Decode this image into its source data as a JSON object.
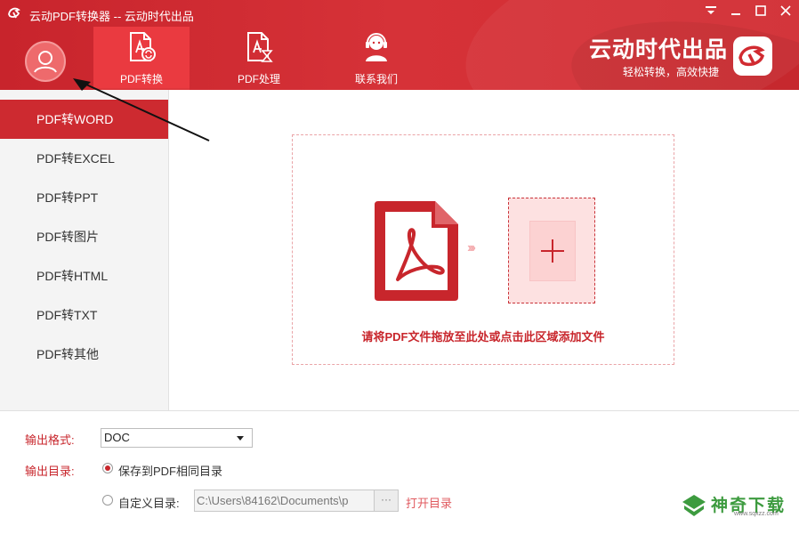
{
  "window": {
    "title": "云动PDF转换器 -- 云动时代出品",
    "buttons": [
      "minimize-dropdown",
      "minimize",
      "maximize",
      "close"
    ]
  },
  "header": {
    "tabs": [
      {
        "label": "PDF转换",
        "icon": "pdf-convert-icon",
        "active": true
      },
      {
        "label": "PDF处理",
        "icon": "pdf-process-icon",
        "active": false
      },
      {
        "label": "联系我们",
        "icon": "contact-support-icon",
        "active": false
      }
    ],
    "brand_name": "云动时代出品",
    "brand_slogan": "轻松转换，高效快捷"
  },
  "sidebar": {
    "items": [
      {
        "label": "PDF转WORD",
        "active": true
      },
      {
        "label": "PDF转EXCEL",
        "active": false
      },
      {
        "label": "PDF转PPT",
        "active": false
      },
      {
        "label": "PDF转图片",
        "active": false
      },
      {
        "label": "PDF转HTML",
        "active": false
      },
      {
        "label": "PDF转TXT",
        "active": false
      },
      {
        "label": "PDF转其他",
        "active": false
      }
    ]
  },
  "dropzone": {
    "hint": "请将PDF文件拖放至此处或点击此区域添加文件",
    "arrows": "›››"
  },
  "options": {
    "format_label": "输出格式:",
    "format_value": "DOC",
    "dir_label": "输出目录:",
    "same_dir_label": "保存到PDF相同目录",
    "same_dir_checked": true,
    "custom_dir_label": "自定义目录:",
    "custom_dir_checked": false,
    "custom_dir_path": "C:\\Users\\84162\\Documents\\p",
    "browse_label": "···",
    "open_dir_label": "打开目录"
  },
  "watermark": {
    "name": "神奇下载",
    "url": "www.sqxzz.com"
  },
  "colors": {
    "primary": "#cd2a30",
    "header": "#d12b31",
    "active_tab": "#ea3a40",
    "accent_text": "#c8262c",
    "watermark_green": "#3d9b3f"
  }
}
